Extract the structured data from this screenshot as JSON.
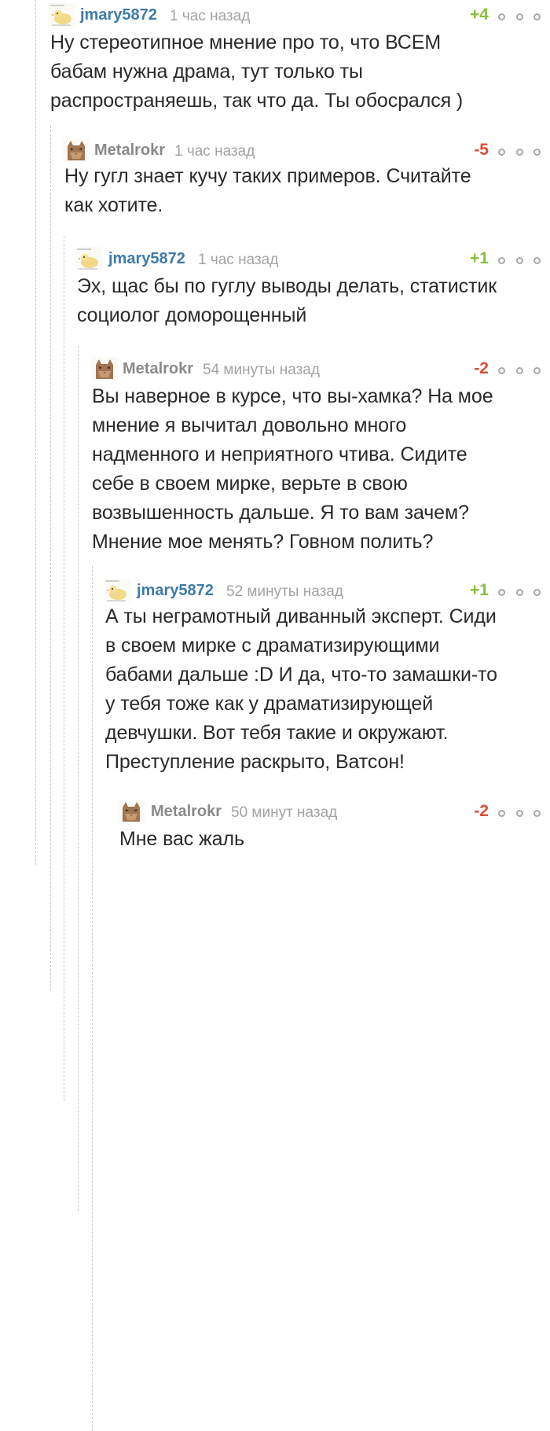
{
  "comments": [
    {
      "username": "jmary5872",
      "avatar": "chicken-avatar-icon",
      "time": "1 час назад",
      "rating": "+4",
      "text": "Ну стереотипное мнение про то, что ВСЕМ\nбабам нужна драма, тут только ты\nраспространяешь, так что да. Ты обосрался )"
    },
    {
      "username": "Metalrokr",
      "avatar": "cat-avatar-icon",
      "time": "1 час назад",
      "rating": "-5",
      "text": "Ну гугл знает кучу таких примеров. Считайте\nкак хотите."
    },
    {
      "username": "jmary5872",
      "avatar": "chicken-avatar-icon",
      "time": "1 час назад",
      "rating": "+1",
      "text": "Эх, щас бы по гуглу выводы делать, статистик\nсоциолог доморощенный"
    },
    {
      "username": "Metalrokr",
      "avatar": "cat-avatar-icon",
      "time": "54 минуты назад",
      "rating": "-2",
      "text": "Вы наверное в курсе, что вы-хамка? На мое\nмнение я вычитал довольно много\nнадменного и неприятного чтива. Сидите\nсебе в своем мирке, верьте в свою\nвозвышенность дальше. Я то вам зачем?\nМнение мое менять? Говном полить?"
    },
    {
      "username": "jmary5872",
      "avatar": "chicken-avatar-icon",
      "time": "52 минуты назад",
      "rating": "+1",
      "text": "А ты неграмотный диванный эксперт. Сиди\nв своем мирке с драматизирующими\nбабами дальше :D И да, что-то замашки-то\nу тебя тоже как у драматизирующей\nдевчушки. Вот тебя такие и окружают.\nПреступление раскрыто, Ватсон!"
    },
    {
      "username": "Metalrokr",
      "avatar": "cat-avatar-icon",
      "time": "50 минут назад",
      "rating": "-2",
      "text": "Мне вас жаль"
    }
  ],
  "colors": {
    "positive": "#8bbd3c",
    "negative": "#dd4b39",
    "username_author": "#3e7ba7",
    "username_other": "#8a8a8a"
  }
}
